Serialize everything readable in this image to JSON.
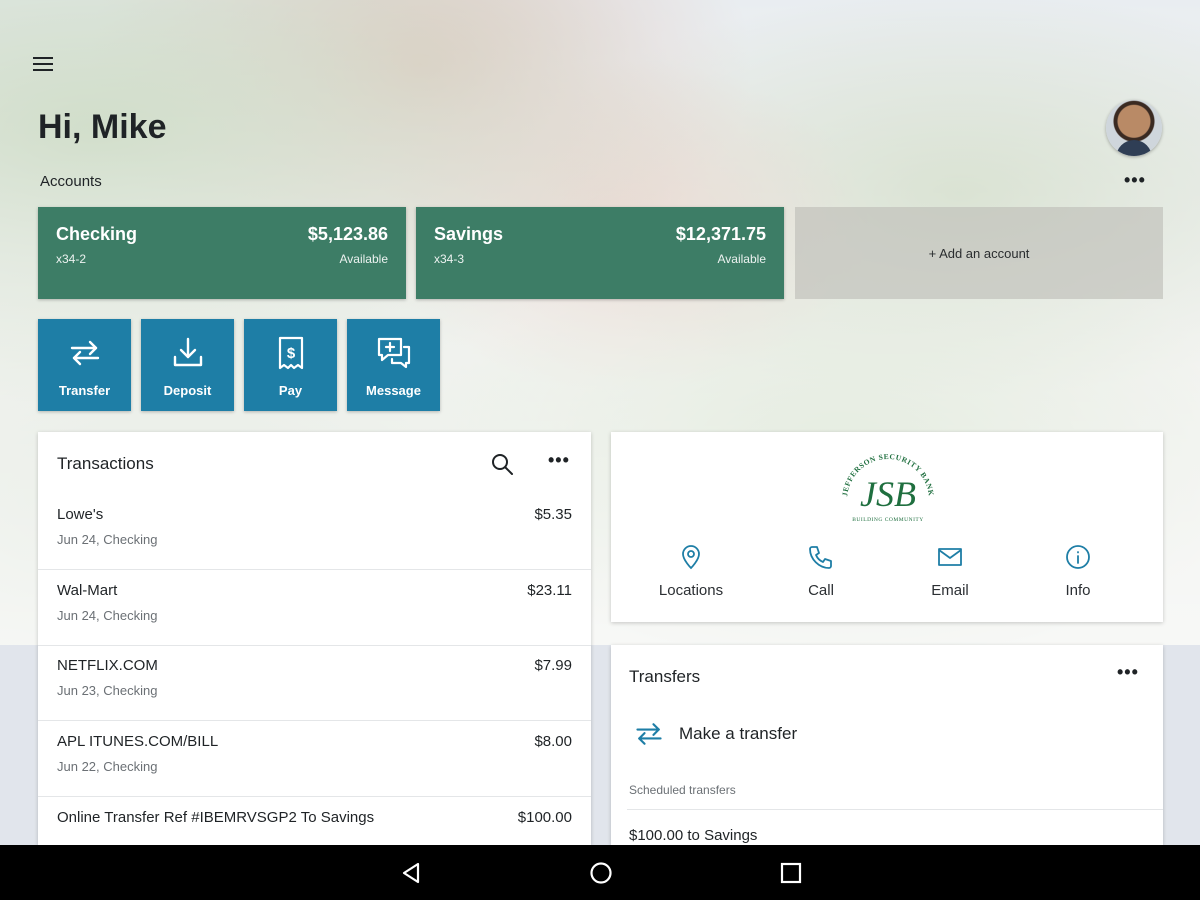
{
  "header": {
    "greeting": "Hi, Mike",
    "accounts_label": "Accounts",
    "more_label": "•••"
  },
  "accounts": [
    {
      "name": "Checking",
      "number": "x34-2",
      "balance": "$5,123.86",
      "status": "Available"
    },
    {
      "name": "Savings",
      "number": "x34-3",
      "balance": "$12,371.75",
      "status": "Available"
    }
  ],
  "add_account_label": "+ Add an account",
  "quick_actions": [
    {
      "label": "Transfer",
      "icon": "transfer-icon"
    },
    {
      "label": "Deposit",
      "icon": "deposit-icon"
    },
    {
      "label": "Pay",
      "icon": "pay-icon"
    },
    {
      "label": "Message",
      "icon": "message-icon"
    }
  ],
  "transactions": {
    "title": "Transactions",
    "items": [
      {
        "merchant": "Lowe's",
        "detail": "Jun 24, Checking",
        "amount": "$5.35"
      },
      {
        "merchant": "Wal-Mart",
        "detail": "Jun 24, Checking",
        "amount": "$23.11"
      },
      {
        "merchant": "NETFLIX.COM",
        "detail": "Jun 23, Checking",
        "amount": "$7.99"
      },
      {
        "merchant": "APL ITUNES.COM/BILL",
        "detail": "Jun 22, Checking",
        "amount": "$8.00"
      },
      {
        "merchant": "Online Transfer Ref #IBEMRVSGP2 To Savings",
        "detail": "",
        "amount": "$100.00"
      }
    ]
  },
  "bank": {
    "logo_text": "JSB",
    "logo_arc_text": "JEFFERSON SECURITY BANK",
    "logo_sub_text": "BUILDING COMMUNITY",
    "contacts": [
      {
        "label": "Locations",
        "icon": "location-pin-icon"
      },
      {
        "label": "Call",
        "icon": "phone-icon"
      },
      {
        "label": "Email",
        "icon": "email-icon"
      },
      {
        "label": "Info",
        "icon": "info-icon"
      }
    ]
  },
  "transfers": {
    "title": "Transfers",
    "make_transfer_label": "Make a transfer",
    "scheduled_label": "Scheduled transfers",
    "scheduled_items": [
      "$100.00 to Savings"
    ]
  },
  "colors": {
    "account_green": "#3d7d66",
    "action_blue": "#1e7ea6",
    "logo_green": "#1f6f3f"
  }
}
